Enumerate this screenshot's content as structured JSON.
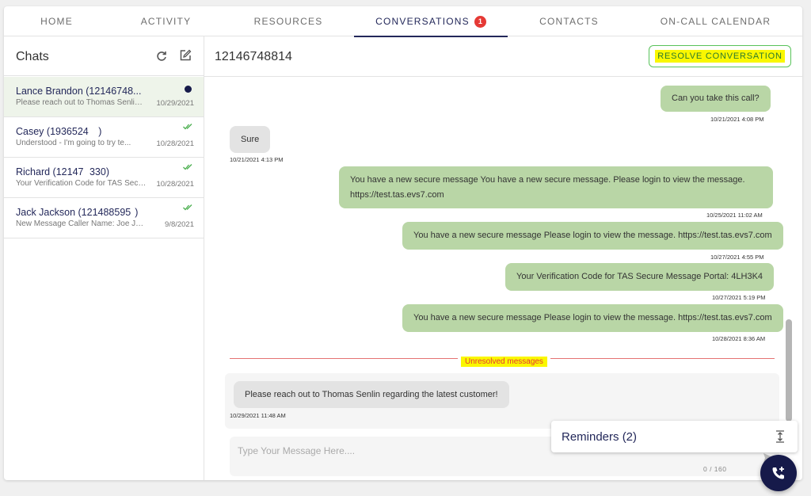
{
  "nav": {
    "tabs": [
      {
        "label": "HOME"
      },
      {
        "label": "ACTIVITY"
      },
      {
        "label": "RESOURCES"
      },
      {
        "label": "CONVERSATIONS",
        "badge": "1"
      },
      {
        "label": "CONTACTS"
      },
      {
        "label": "ON-CALL CALENDAR"
      }
    ],
    "active": "CONVERSATIONS"
  },
  "sidebar": {
    "title": "Chats",
    "chats": [
      {
        "name": "Lance Brandon (12146748...",
        "preview": "Please reach out to Thomas Senlin regarding the latest customer!",
        "date": "10/29/2021",
        "status": "unread"
      },
      {
        "name": "Casey (1936524     )",
        "preview": "Understood - I'm going to try te...",
        "date": "10/28/2021",
        "status": "read"
      },
      {
        "name": "Richard (12147   330)",
        "preview": "Your Verification Code for TAS Secure Message Portal",
        "date": "10/28/2021",
        "status": "read"
      },
      {
        "name": "Jack Jackson (121488595  )",
        "preview": "New Message Caller Name: Joe Jones",
        "date": "9/8/2021",
        "status": "read"
      }
    ]
  },
  "conversation": {
    "title": "12146748814",
    "resolve_label": "RESOLVE CONVERSATION",
    "messages": [
      {
        "direction": "out",
        "text": "Can you take this call?",
        "time": "10/21/2021 4:08 PM"
      },
      {
        "direction": "in",
        "text": "Sure",
        "time": "10/21/2021 4:13 PM"
      },
      {
        "direction": "out",
        "text": "You have a new secure message You have a new secure message. Please login to view the message.",
        "text2": "https://test.tas.evs7.com",
        "time": "10/25/2021 11:02 AM"
      },
      {
        "direction": "out",
        "text": "You have a new secure message Please login to view the message. https://test.tas.evs7.com",
        "time": "10/27/2021 4:55 PM"
      },
      {
        "direction": "out",
        "text": "Your Verification Code for TAS Secure Message Portal: 4LH3K4",
        "time": "10/27/2021 5:19 PM"
      },
      {
        "direction": "out",
        "text": "You have a new secure message Please login to view the message. https://test.tas.evs7.com",
        "time": "10/28/2021 8:36 AM"
      }
    ],
    "unresolved_label": "Unresolved messages",
    "unresolved_messages": [
      {
        "direction": "in",
        "text": "Please reach out to Thomas Senlin regarding the latest customer!",
        "time": "10/29/2021 11:48 AM"
      }
    ],
    "composer": {
      "placeholder": "Type Your Message Here....",
      "char_count": "0 / 160"
    },
    "reminders_label": "Reminders (2)"
  },
  "icons": {
    "refresh": "refresh-icon",
    "compose": "compose-icon",
    "read_check": "double-check-icon",
    "send": "send-icon",
    "expand": "expand-icon",
    "call": "phone-plus-icon"
  },
  "colors": {
    "accent": "#23285a",
    "bubble_out": "#b9d6a6",
    "bubble_in": "#e3e3e3",
    "badge": "#e53935",
    "resolve_border": "#58c35a"
  }
}
